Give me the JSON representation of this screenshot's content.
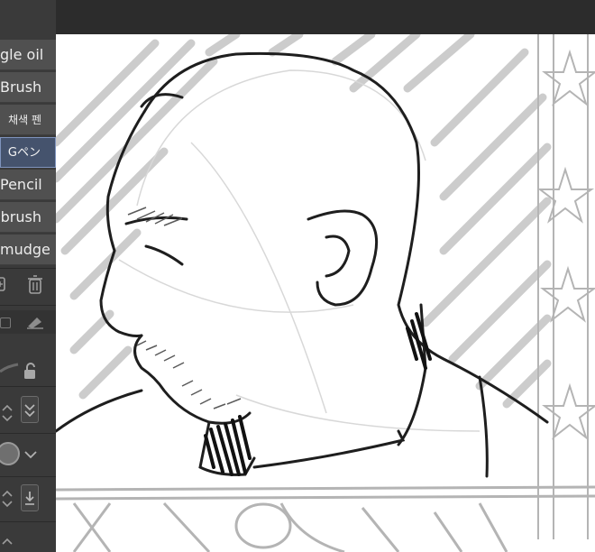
{
  "brushes": [
    {
      "label": "gle oil",
      "selected": false
    },
    {
      "label": "Brush",
      "selected": false
    },
    {
      "label": "채색 펜",
      "selected": false
    },
    {
      "label": "Gペン",
      "selected": true
    },
    {
      "label": "Pencil",
      "selected": false
    },
    {
      "label": "brush",
      "selected": false
    },
    {
      "label": "mudge",
      "selected": false
    }
  ],
  "icons": {
    "copy": "copy-brush-icon",
    "delete": "trash-icon",
    "lock": "lock-icon",
    "chevron": "chevron-down-icon",
    "stabilize": "stabilization-icon",
    "download": "download-icon"
  },
  "colors": {
    "panel": "#3a3a3a",
    "item": "#505050",
    "selected": "#45536d",
    "selected_border": "#7f93bd",
    "canvas": "#ffffff"
  }
}
